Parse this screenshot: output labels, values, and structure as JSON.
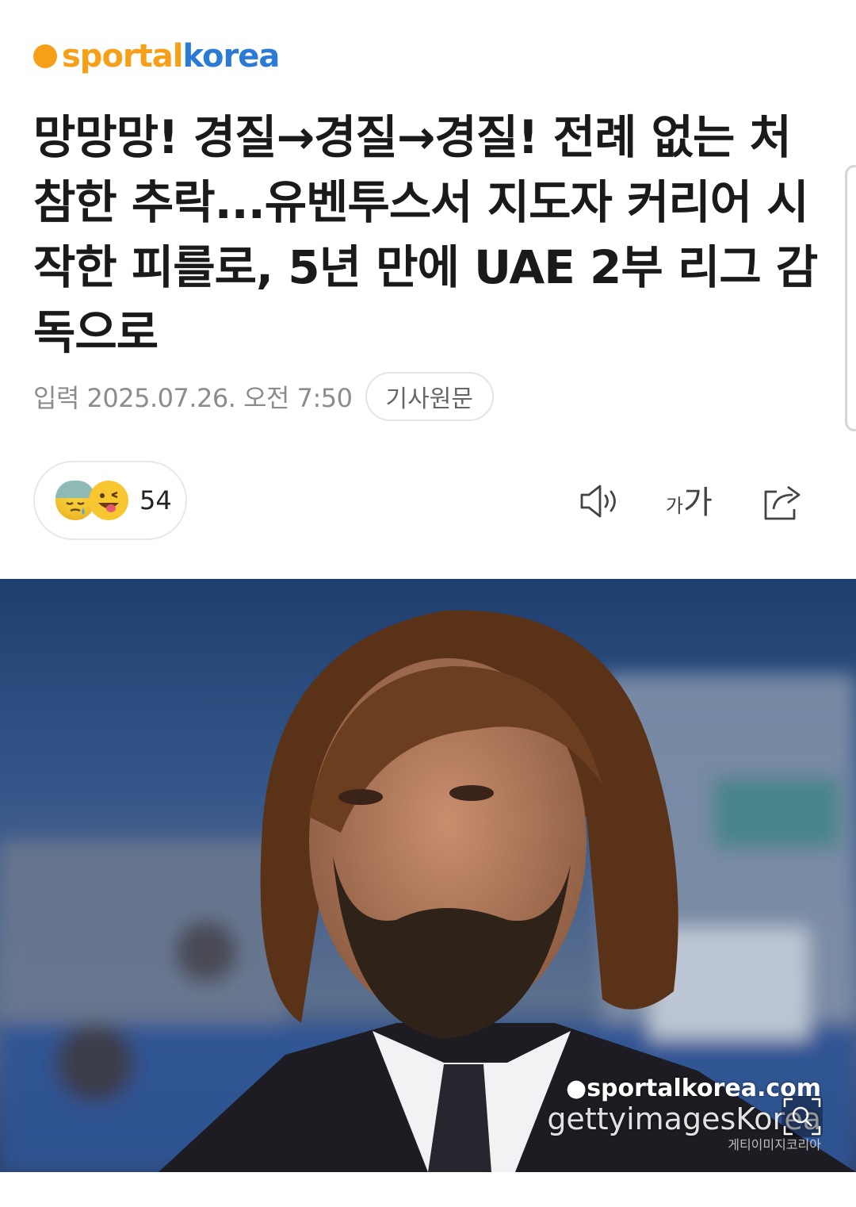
{
  "logo": {
    "part1": "sportal",
    "part2": "korea"
  },
  "headline": "망망망! 경질→경질→경질! 전례 없는 처참한 추락...유벤투스서 지도자 커리어 시작한 피를로, 5년 만에 UAE 2부 리그 감독으로",
  "meta": {
    "date": "입력 2025.07.26. 오전 7:50",
    "original_article": "기사원문"
  },
  "reactions": {
    "count": "54",
    "icons": [
      "sad-tear-emoji",
      "tongue-emoji"
    ]
  },
  "toolbar": {
    "font_size_small": "가",
    "font_size_large": "가",
    "icons": [
      "speaker-icon",
      "font-size-icon",
      "share-icon"
    ]
  },
  "photo": {
    "watermark_line1": "●sportalkorea.com",
    "watermark_line2": "gettyimagesKorea",
    "watermark_line3": "게티이미지코리아"
  },
  "colors": {
    "brand_orange": "#f5a018",
    "brand_blue": "#2b7bd6"
  }
}
